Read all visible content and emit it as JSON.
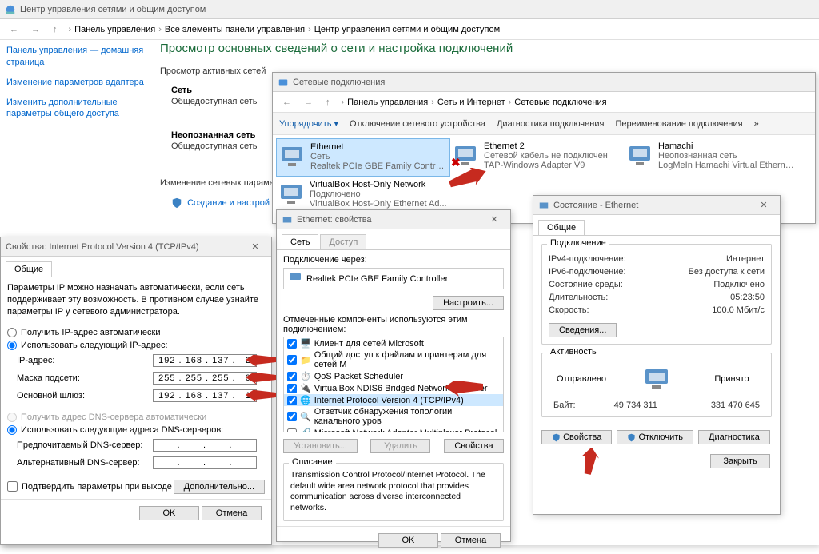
{
  "main": {
    "title": "Центр управления сетями и общим доступом",
    "breadcrumb": [
      "Панель управления",
      "Все элементы панели управления",
      "Центр управления сетями и общим доступом"
    ],
    "sidebar": {
      "home": "Панель управления — домашняя страница",
      "adapter": "Изменение параметров адаптера",
      "sharing": "Изменить дополнительные параметры общего доступа"
    },
    "heading": "Просмотр основных сведений о сети и настройка подключений",
    "active_label": "Просмотр активных сетей",
    "net1_name": "Сеть",
    "net1_type": "Общедоступная сеть",
    "net2_name": "Неопознанная сеть",
    "net2_type": "Общедоступная сеть",
    "change_label": "Изменение сетевых параметров",
    "create_link": "Создание и настрой"
  },
  "nc": {
    "title": "Сетевые подключения",
    "breadcrumb": [
      "Панель управления",
      "Сеть и Интернет",
      "Сетевые подключения"
    ],
    "toolbar": {
      "organize": "Упорядочить",
      "disable": "Отключение сетевого устройства",
      "diag": "Диагностика подключения",
      "rename": "Переименование подключения"
    },
    "items": [
      {
        "name": "Ethernet",
        "status": "Сеть",
        "dev": "Realtek PCIe GBE Family Controller"
      },
      {
        "name": "Ethernet 2",
        "status": "Сетевой кабель не подключен",
        "dev": "TAP-Windows Adapter V9"
      },
      {
        "name": "Hamachi",
        "status": "Неопознанная сеть",
        "dev": "LogMeIn Hamachi Virtual Etherne..."
      },
      {
        "name": "VirtualBox Host-Only Network",
        "status": "Подключено",
        "dev": "VirtualBox Host-Only Ethernet Ad..."
      }
    ]
  },
  "status": {
    "title": "Состояние - Ethernet",
    "tab": "Общие",
    "group1": "Подключение",
    "ipv4_k": "IPv4-подключение:",
    "ipv4_v": "Интернет",
    "ipv6_k": "IPv6-подключение:",
    "ipv6_v": "Без доступа к сети",
    "media_k": "Состояние среды:",
    "media_v": "Подключено",
    "dur_k": "Длительность:",
    "dur_v": "05:23:50",
    "speed_k": "Скорость:",
    "speed_v": "100.0 Мбит/с",
    "details": "Сведения...",
    "group2": "Активность",
    "sent": "Отправлено",
    "recv": "Принято",
    "bytes_k": "Байт:",
    "bytes_s": "49 734 311",
    "bytes_r": "331 470 645",
    "props": "Свойства",
    "disable": "Отключить",
    "diag": "Диагностика",
    "close": "Закрыть"
  },
  "ethprop": {
    "title": "Ethernet: свойства",
    "tab1": "Сеть",
    "tab2": "Доступ",
    "conn_via": "Подключение через:",
    "dev": "Realtek PCIe GBE Family Controller",
    "configure": "Настроить...",
    "used_label": "Отмеченные компоненты используются этим подключением:",
    "components": [
      "Клиент для сетей Microsoft",
      "Общий доступ к файлам и принтерам для сетей M",
      "QoS Packet Scheduler",
      "VirtualBox NDIS6 Bridged Networking Driver",
      "Internet Protocol Version 4 (TCP/IPv4)",
      "Ответчик обнаружения топологии канального уров",
      "Microsoft Network Adapter Multiplexor Protocol"
    ],
    "install": "Установить...",
    "remove": "Удалить",
    "props": "Свойства",
    "desc_label": "Описание",
    "desc": "Transmission Control Protocol/Internet Protocol. The default wide area network protocol that provides communication across diverse interconnected networks.",
    "ok": "OK",
    "cancel": "Отмена"
  },
  "ipv4": {
    "title": "Свойства: Internet Protocol Version 4 (TCP/IPv4)",
    "tab": "Общие",
    "intro": "Параметры IP можно назначать автоматически, если сеть поддерживает эту возможность. В противном случае узнайте параметры IP у сетевого администратора.",
    "auto_ip": "Получить IP-адрес автоматически",
    "manual_ip": "Использовать следующий IP-адрес:",
    "ip_k": "IP-адрес:",
    "ip_v": "192 . 168 . 137 .   2",
    "mask_k": "Маска подсети:",
    "mask_v": "255 . 255 . 255 .   0",
    "gw_k": "Основной шлюз:",
    "gw_v": "192 . 168 . 137 .   1",
    "auto_dns": "Получить адрес DNS-сервера автоматически",
    "manual_dns": "Использовать следующие адреса DNS-серверов:",
    "dns1_k": "Предпочитаемый DNS-сервер:",
    "dns1_v": ".       .       .",
    "dns2_k": "Альтернативный DNS-сервер:",
    "dns2_v": ".       .       .",
    "validate": "Подтвердить параметры при выходе",
    "advanced": "Дополнительно...",
    "ok": "OK",
    "cancel": "Отмена"
  }
}
